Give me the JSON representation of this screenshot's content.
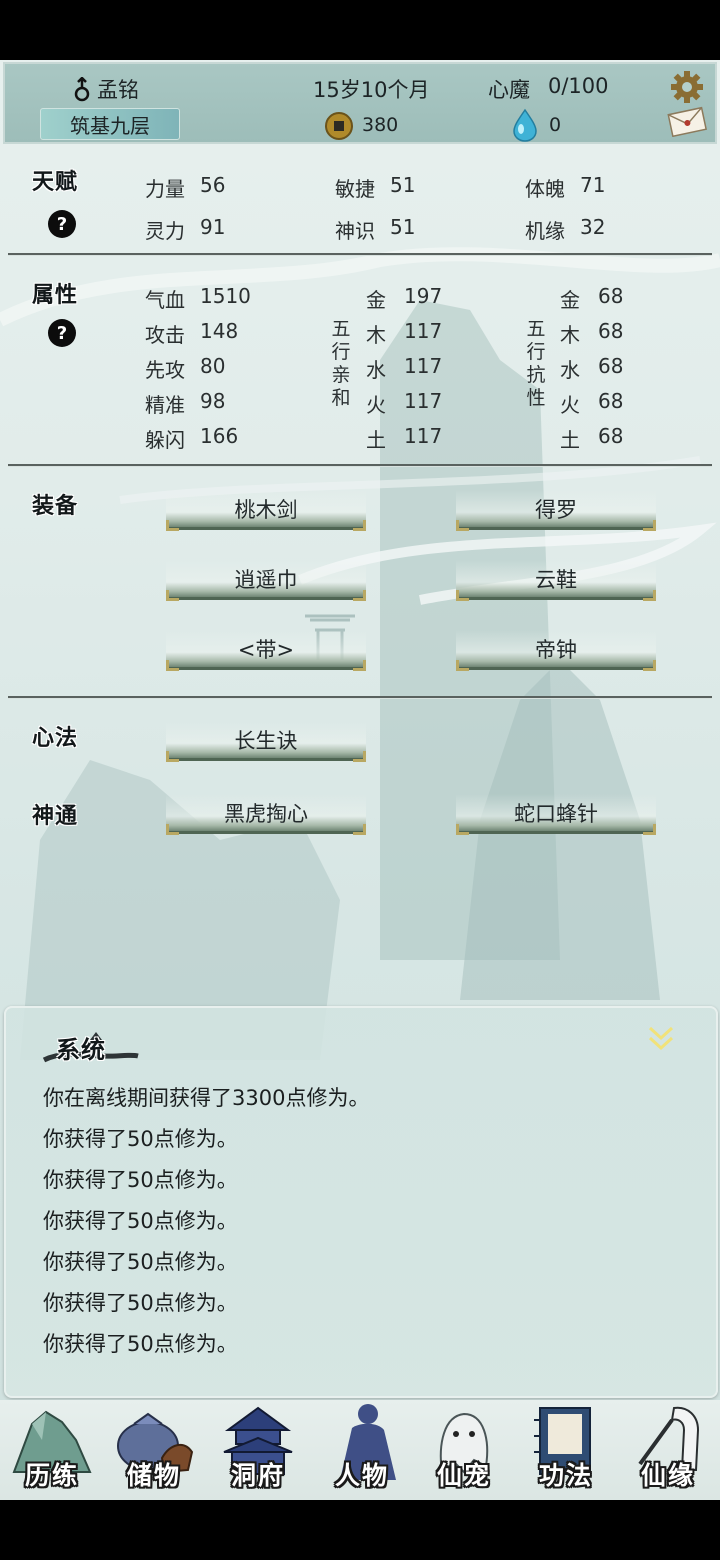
{
  "header": {
    "name": "孟铭",
    "realm": "筑基九层",
    "age": "15岁10个月",
    "heart_demon_label": "心魔",
    "heart_demon_value": "0/100",
    "coins": "380",
    "gems": "0"
  },
  "talent": {
    "title": "天赋",
    "help": "?",
    "stats": [
      {
        "label": "力量",
        "value": "56"
      },
      {
        "label": "敏捷",
        "value": "51"
      },
      {
        "label": "体魄",
        "value": "71"
      },
      {
        "label": "灵力",
        "value": "91"
      },
      {
        "label": "神识",
        "value": "51"
      },
      {
        "label": "机缘",
        "value": "32"
      }
    ]
  },
  "attributes": {
    "title": "属性",
    "help": "?",
    "basic": [
      {
        "label": "气血",
        "value": "1510"
      },
      {
        "label": "攻击",
        "value": "148"
      },
      {
        "label": "先攻",
        "value": "80"
      },
      {
        "label": "精准",
        "value": "98"
      },
      {
        "label": "躲闪",
        "value": "166"
      }
    ],
    "affinity_title": [
      "五",
      "行",
      "亲",
      "和"
    ],
    "affinity": [
      {
        "element": "金",
        "value": "197"
      },
      {
        "element": "木",
        "value": "117"
      },
      {
        "element": "水",
        "value": "117"
      },
      {
        "element": "火",
        "value": "117"
      },
      {
        "element": "土",
        "value": "117"
      }
    ],
    "resist_title": [
      "五",
      "行",
      "抗",
      "性"
    ],
    "resist": [
      {
        "element": "金",
        "value": "68"
      },
      {
        "element": "木",
        "value": "68"
      },
      {
        "element": "水",
        "value": "68"
      },
      {
        "element": "火",
        "value": "68"
      },
      {
        "element": "土",
        "value": "68"
      }
    ]
  },
  "equipment": {
    "title": "装备",
    "slots": [
      "桃木剑",
      "得罗",
      "逍遥巾",
      "云鞋",
      "<带>",
      "帝钟"
    ]
  },
  "method": {
    "title": "心法",
    "item": "长生诀"
  },
  "skills": {
    "title": "神通",
    "items": [
      "黑虎掏心",
      "蛇口蜂针"
    ]
  },
  "log": {
    "title": "系统",
    "lines": [
      "你在离线期间获得了3300点修为。",
      "你获得了50点修为。",
      "你获得了50点修为。",
      "你获得了50点修为。",
      "你获得了50点修为。",
      "你获得了50点修为。",
      "你获得了50点修为。"
    ]
  },
  "nav": [
    "历练",
    "储物",
    "洞府",
    "人物",
    "仙宠",
    "功法",
    "仙缘"
  ],
  "colors": {
    "header": "#a9c7c3",
    "background": "#dfeae8",
    "coin": "#b08a2a",
    "gem": "#3fb2d6"
  }
}
